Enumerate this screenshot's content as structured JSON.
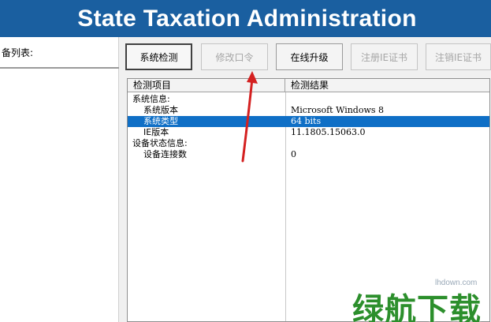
{
  "header": {
    "title": "State Taxation Administration"
  },
  "left_panel": {
    "label": "备列表:"
  },
  "toolbar": {
    "buttons": [
      {
        "label": "系统检测",
        "state": "active"
      },
      {
        "label": "修改口令",
        "state": "disabled"
      },
      {
        "label": "在线升级",
        "state": "enabled"
      },
      {
        "label": "注册IE证书",
        "state": "disabled"
      },
      {
        "label": "注销IE证书",
        "state": "disabled"
      }
    ]
  },
  "results": {
    "columns": [
      "检测项目",
      "检测结果"
    ],
    "rows": [
      {
        "item": "系统信息:",
        "value": ""
      },
      {
        "item": "系统版本",
        "value": "Microsoft Windows 8"
      },
      {
        "item": "系统类型",
        "value": "64 bits",
        "selected": true
      },
      {
        "item": "IE版本",
        "value": "11.1805.15063.0"
      },
      {
        "item": "设备状态信息:",
        "value": ""
      },
      {
        "item": "设备连接数",
        "value": "0"
      }
    ]
  },
  "watermark": {
    "site": "lhdown.com",
    "brand": "绿航下载"
  },
  "colors": {
    "header_bg": "#1a5fa0",
    "selection": "#0f6fc6",
    "arrow": "#d42020",
    "watermark": "#2c8f2c"
  }
}
